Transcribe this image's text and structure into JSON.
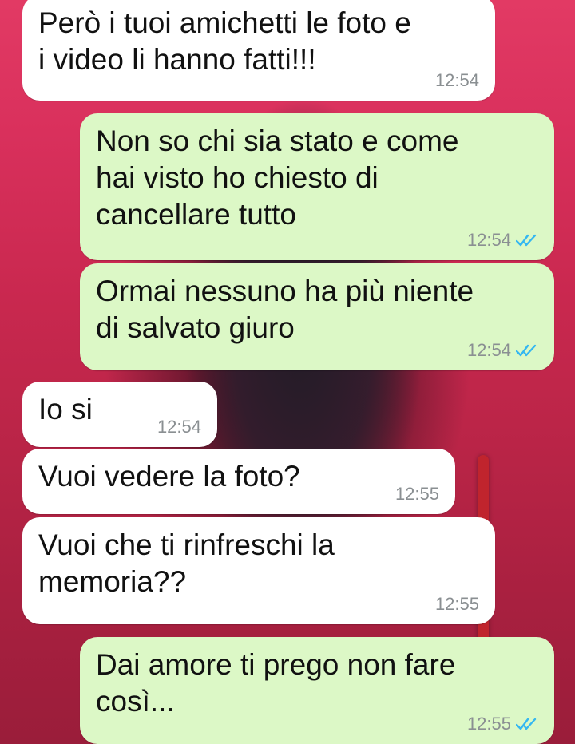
{
  "colors": {
    "incoming_bubble": "#ffffff",
    "outgoing_bubble": "#dcf8c6",
    "read_ticks": "#34b7f1",
    "wallpaper": "#d42f59"
  },
  "messages": [
    {
      "direction": "incoming",
      "text": "Però i tuoi amichetti le foto e\ni video li hanno fatti!!!",
      "time": "12:54"
    },
    {
      "direction": "outgoing",
      "text": "Non so chi sia stato e come\nhai visto ho chiesto di\ncancellare tutto",
      "time": "12:54",
      "status": "read-double-check-icon"
    },
    {
      "direction": "outgoing",
      "text": "Ormai nessuno ha più niente\ndi salvato giuro",
      "time": "12:54",
      "status": "read-double-check-icon"
    },
    {
      "direction": "incoming",
      "text": "Io si",
      "time": "12:54"
    },
    {
      "direction": "incoming",
      "text": "Vuoi vedere la foto?",
      "time": "12:55"
    },
    {
      "direction": "incoming",
      "text": "Vuoi che ti rinfreschi la\nmemoria??",
      "time": "12:55"
    },
    {
      "direction": "outgoing",
      "text": "Dai amore ti prego non fare\ncosì...",
      "time": "12:55",
      "status": "read-double-check-icon"
    }
  ]
}
